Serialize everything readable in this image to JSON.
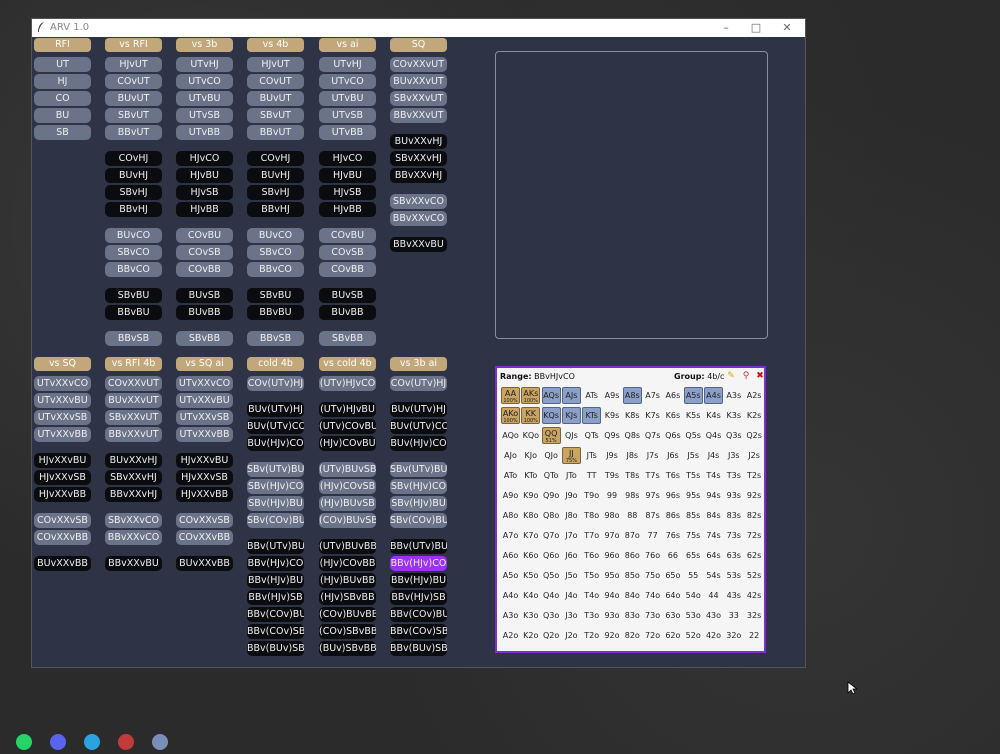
{
  "window": {
    "title": "ARV 1.0",
    "minimize": "–",
    "maximize": "□",
    "close": "✕"
  },
  "colors": {
    "header": "#c2a77a",
    "light": "#6b7389",
    "dark": "#0b0c10",
    "selected": "#9b30ff",
    "gold": "#c9a462",
    "blue": "#8aa0c8"
  },
  "top_columns": [
    {
      "header": "RFI",
      "groups": [
        [
          "UT",
          "HJ",
          "CO",
          "BU",
          "SB"
        ]
      ],
      "styles": [
        "light"
      ]
    },
    {
      "header": "vs RFI",
      "groups": [
        [
          "HJvUT",
          "COvUT",
          "BUvUT",
          "SBvUT",
          "BBvUT"
        ],
        [
          "COvHJ",
          "BUvHJ",
          "SBvHJ",
          "BBvHJ"
        ],
        [
          "BUvCO",
          "SBvCO",
          "BBvCO"
        ],
        [
          "SBvBU",
          "BBvBU"
        ],
        [
          "BBvSB"
        ]
      ],
      "styles": [
        "light",
        "dark",
        "light",
        "dark",
        "light"
      ]
    },
    {
      "header": "vs 3b",
      "groups": [
        [
          "UTvHJ",
          "UTvCO",
          "UTvBU",
          "UTvSB",
          "UTvBB"
        ],
        [
          "HJvCO",
          "HJvBU",
          "HJvSB",
          "HJvBB"
        ],
        [
          "COvBU",
          "COvSB",
          "COvBB"
        ],
        [
          "BUvSB",
          "BUvBB"
        ],
        [
          "SBvBB"
        ]
      ],
      "styles": [
        "light",
        "dark",
        "light",
        "dark",
        "light"
      ]
    },
    {
      "header": "vs 4b",
      "groups": [
        [
          "HJvUT",
          "COvUT",
          "BUvUT",
          "SBvUT",
          "BBvUT"
        ],
        [
          "COvHJ",
          "BUvHJ",
          "SBvHJ",
          "BBvHJ"
        ],
        [
          "BUvCO",
          "SBvCO",
          "BBvCO"
        ],
        [
          "SBvBU",
          "BBvBU"
        ],
        [
          "BBvSB"
        ]
      ],
      "styles": [
        "light",
        "dark",
        "light",
        "dark",
        "light"
      ]
    },
    {
      "header": "vs ai",
      "groups": [
        [
          "UTvHJ",
          "UTvCO",
          "UTvBU",
          "UTvSB",
          "UTvBB"
        ],
        [
          "HJvCO",
          "HJvBU",
          "HJvSB",
          "HJvBB"
        ],
        [
          "COvBU",
          "COvSB",
          "COvBB"
        ],
        [
          "BUvSB",
          "BUvBB"
        ],
        [
          "SBvBB"
        ]
      ],
      "styles": [
        "light",
        "dark",
        "light",
        "dark",
        "light"
      ]
    },
    {
      "header": "SQ",
      "groups": [
        [
          "COvXXvUT",
          "BUvXXvUT",
          "SBvXXvUT",
          "BBvXXvUT"
        ],
        [
          "BUvXXvHJ",
          "SBvXXvHJ",
          "BBvXXvHJ"
        ],
        [
          "SBvXXvCO",
          "BBvXXvCO"
        ],
        [
          "BBvXXvBU"
        ]
      ],
      "styles": [
        "light",
        "dark",
        "light",
        "dark"
      ]
    }
  ],
  "bottom_columns": [
    {
      "header": "vs SQ",
      "groups": [
        [
          "UTvXXvCO",
          "UTvXXvBU",
          "UTvXXvSB",
          "UTvXXvBB"
        ],
        [
          "HJvXXvBU",
          "HJvXXvSB",
          "HJvXXvBB"
        ],
        [
          "COvXXvSB",
          "COvXXvBB"
        ],
        [
          "BUvXXvBB"
        ]
      ],
      "styles": [
        "light",
        "dark",
        "light",
        "dark"
      ]
    },
    {
      "header": "vs RFI 4b",
      "groups": [
        [
          "COvXXvUT",
          "BUvXXvUT",
          "SBvXXvUT",
          "BBvXXvUT"
        ],
        [
          "BUvXXvHJ",
          "SBvXXvHJ",
          "BBvXXvHJ"
        ],
        [
          "SBvXXvCO",
          "BBvXXvCO"
        ],
        [
          "BBvXXvBU"
        ]
      ],
      "styles": [
        "light",
        "dark",
        "light",
        "dark"
      ]
    },
    {
      "header": "vs SQ ai",
      "groups": [
        [
          "UTvXXvCO",
          "UTvXXvBU",
          "UTvXXvSB",
          "UTvXXvBB"
        ],
        [
          "HJvXXvBU",
          "HJvXXvSB",
          "HJvXXvBB"
        ],
        [
          "COvXXvSB",
          "COvXXvBB"
        ],
        [
          "BUvXXvBB"
        ]
      ],
      "styles": [
        "light",
        "dark",
        "light",
        "dark"
      ]
    },
    {
      "header": "cold 4b",
      "groups": [
        [
          "COv(UTv)HJ"
        ],
        [
          "BUv(UTv)HJ",
          "BUv(UTv)CO",
          "BUv(HJv)CO"
        ],
        [
          "SBv(UTv)BU",
          "SBv(HJv)CO",
          "SBv(HJv)BU",
          "SBv(COv)BU"
        ],
        [
          "BBv(UTv)BU",
          "BBv(HJv)CO",
          "BBv(HJv)BU",
          "BBv(HJv)SB",
          "BBv(COv)BU",
          "BBv(COv)SB",
          "BBv(BUv)SB"
        ]
      ],
      "styles": [
        "light",
        "dark",
        "light",
        "dark"
      ]
    },
    {
      "header": "vs cold 4b",
      "groups": [
        [
          "(UTv)HJvCO"
        ],
        [
          "(UTv)HJvBU",
          "(UTv)COvBU",
          "(HJv)COvBU"
        ],
        [
          "(UTv)BUvSB",
          "(HJv)COvSB",
          "(HJv)BUvSB",
          "(COv)BUvSB"
        ],
        [
          "(UTv)BUvBB",
          "(HJv)COvBB",
          "(HJv)BUvBB",
          "(HJv)SBvBB",
          "(COv)BUvBB",
          "(COv)SBvBB",
          "(BUv)SBvBB"
        ]
      ],
      "styles": [
        "light",
        "dark",
        "light",
        "dark"
      ]
    },
    {
      "header": "vs 3b ai",
      "groups": [
        [
          "COv(UTv)HJ"
        ],
        [
          "BUv(UTv)HJ",
          "BUv(UTv)CO",
          "BUv(HJv)CO"
        ],
        [
          "SBv(UTv)BU",
          "SBv(HJv)CO",
          "SBv(HJv)BU",
          "SBv(COv)BU"
        ],
        [
          "BBv(UTv)BU",
          "BBv(HJv)CO",
          "BBv(HJv)BU",
          "BBv(HJv)SB",
          "BBv(COv)BU",
          "BBv(COv)SB",
          "BBv(BUv)SB"
        ]
      ],
      "styles": [
        "light",
        "dark",
        "light",
        "dark"
      ],
      "selected": "BBv(HJv)CO"
    }
  ],
  "range": {
    "label": "Range:",
    "value": "BBvHJvCO",
    "group_label": "Group:",
    "group_value": "4b/c",
    "icons": [
      "pencil-icon",
      "broom-icon",
      "close-icon"
    ],
    "grid": [
      [
        "AA",
        "AKs",
        "AQs",
        "AJs",
        "ATs",
        "A9s",
        "A8s",
        "A7s",
        "A6s",
        "A5s",
        "A4s",
        "A3s",
        "A2s"
      ],
      [
        "AKo",
        "KK",
        "KQs",
        "KJs",
        "KTs",
        "K9s",
        "K8s",
        "K7s",
        "K6s",
        "K5s",
        "K4s",
        "K3s",
        "K2s"
      ],
      [
        "AQo",
        "KQo",
        "QQ",
        "QJs",
        "QTs",
        "Q9s",
        "Q8s",
        "Q7s",
        "Q6s",
        "Q5s",
        "Q4s",
        "Q3s",
        "Q2s"
      ],
      [
        "AJo",
        "KJo",
        "QJo",
        "JJ",
        "JTs",
        "J9s",
        "J8s",
        "J7s",
        "J6s",
        "J5s",
        "J4s",
        "J3s",
        "J2s"
      ],
      [
        "ATo",
        "KTo",
        "QTo",
        "JTo",
        "TT",
        "T9s",
        "T8s",
        "T7s",
        "T6s",
        "T5s",
        "T4s",
        "T3s",
        "T2s"
      ],
      [
        "A9o",
        "K9o",
        "Q9o",
        "J9o",
        "T9o",
        "99",
        "98s",
        "97s",
        "96s",
        "95s",
        "94s",
        "93s",
        "92s"
      ],
      [
        "A8o",
        "K8o",
        "Q8o",
        "J8o",
        "T8o",
        "98o",
        "88",
        "87s",
        "86s",
        "85s",
        "84s",
        "83s",
        "82s"
      ],
      [
        "A7o",
        "K7o",
        "Q7o",
        "J7o",
        "T7o",
        "97o",
        "87o",
        "77",
        "76s",
        "75s",
        "74s",
        "73s",
        "72s"
      ],
      [
        "A6o",
        "K6o",
        "Q6o",
        "J6o",
        "T6o",
        "96o",
        "86o",
        "76o",
        "66",
        "65s",
        "64s",
        "63s",
        "62s"
      ],
      [
        "A5o",
        "K5o",
        "Q5o",
        "J5o",
        "T5o",
        "95o",
        "85o",
        "75o",
        "65o",
        "55",
        "54s",
        "53s",
        "52s"
      ],
      [
        "A4o",
        "K4o",
        "Q4o",
        "J4o",
        "T4o",
        "94o",
        "84o",
        "74o",
        "64o",
        "54o",
        "44",
        "43s",
        "42s"
      ],
      [
        "A3o",
        "K3o",
        "Q3o",
        "J3o",
        "T3o",
        "93o",
        "83o",
        "73o",
        "63o",
        "53o",
        "43o",
        "33",
        "32s"
      ],
      [
        "A2o",
        "K2o",
        "Q2o",
        "J2o",
        "T2o",
        "92o",
        "82o",
        "72o",
        "62o",
        "52o",
        "42o",
        "32o",
        "22"
      ]
    ],
    "gold": {
      "AA": "100%",
      "AKs": "100%",
      "AKo": "100%",
      "KK": "100%",
      "QQ": "51%",
      "JJ": "75%"
    },
    "blue": [
      "AQs",
      "AJs",
      "A8s",
      "A5s",
      "A4s",
      "KQs",
      "KJs",
      "KTs"
    ]
  },
  "taskbar": [
    {
      "name": "whatsapp-icon",
      "color": "#25d366"
    },
    {
      "name": "discord-icon",
      "color": "#5865f2"
    },
    {
      "name": "telegram-icon",
      "color": "#2aa3e0"
    },
    {
      "name": "blocked-app-icon",
      "color": "#c23a3a"
    },
    {
      "name": "quill-icon",
      "color": "#7a8fb8"
    }
  ]
}
